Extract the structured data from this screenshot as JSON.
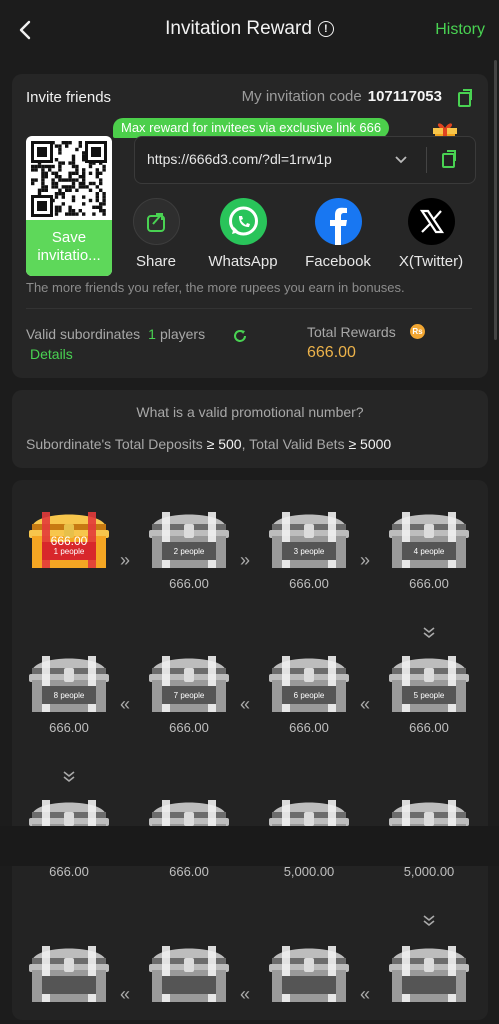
{
  "header": {
    "title": "Invitation Reward",
    "history_label": "History"
  },
  "invite": {
    "title": "Invite friends",
    "code_label": "My invitation code",
    "code_value": "107117053",
    "tip": "Max reward for invitees via exclusive link 666",
    "save_label": "Save invitatio...",
    "link": "https://666d3.com/?dl=1rrw1p",
    "share_items": [
      {
        "label": "Share",
        "icon": "share-icon"
      },
      {
        "label": "WhatsApp",
        "icon": "whatsapp-icon"
      },
      {
        "label": "Facebook",
        "icon": "facebook-icon"
      },
      {
        "label": "X(Twitter)",
        "icon": "x-icon"
      }
    ],
    "note": "The more friends you refer, the more rupees you earn in bonuses.",
    "valid_label": "Valid subordinates",
    "valid_count": "1",
    "valid_unit": "players",
    "details_label": "Details",
    "total_label": "Total Rewards",
    "currency_badge": "Rs",
    "total_value": "666.00"
  },
  "promo": {
    "question": "What is a valid promotional number?",
    "cond1_label": "Subordinate's Total Deposits",
    "cond1_value": "≥ 500",
    "cond2_label": "Total Valid Bets",
    "cond2_value": "≥ 5000"
  },
  "chests": [
    {
      "label": "1 people",
      "amount": "666.00",
      "active": true
    },
    {
      "label": "2 people",
      "amount": "666.00"
    },
    {
      "label": "3 people",
      "amount": "666.00"
    },
    {
      "label": "4 people",
      "amount": "666.00"
    },
    {
      "label": "5 people",
      "amount": "666.00"
    },
    {
      "label": "6 people",
      "amount": "666.00"
    },
    {
      "label": "7 people",
      "amount": "666.00"
    },
    {
      "label": "8 people",
      "amount": "666.00"
    },
    {
      "label": "",
      "amount": "666.00"
    },
    {
      "label": "",
      "amount": "666.00"
    },
    {
      "label": "",
      "amount": "5,000.00"
    },
    {
      "label": "",
      "amount": "5,000.00"
    },
    {
      "label": "",
      "amount": ""
    },
    {
      "label": "",
      "amount": ""
    },
    {
      "label": "",
      "amount": ""
    },
    {
      "label": "",
      "amount": ""
    }
  ],
  "colors": {
    "accent": "#49d252",
    "gold": "#ecb24a",
    "bg": "#1c1c1c",
    "card": "#262626"
  }
}
